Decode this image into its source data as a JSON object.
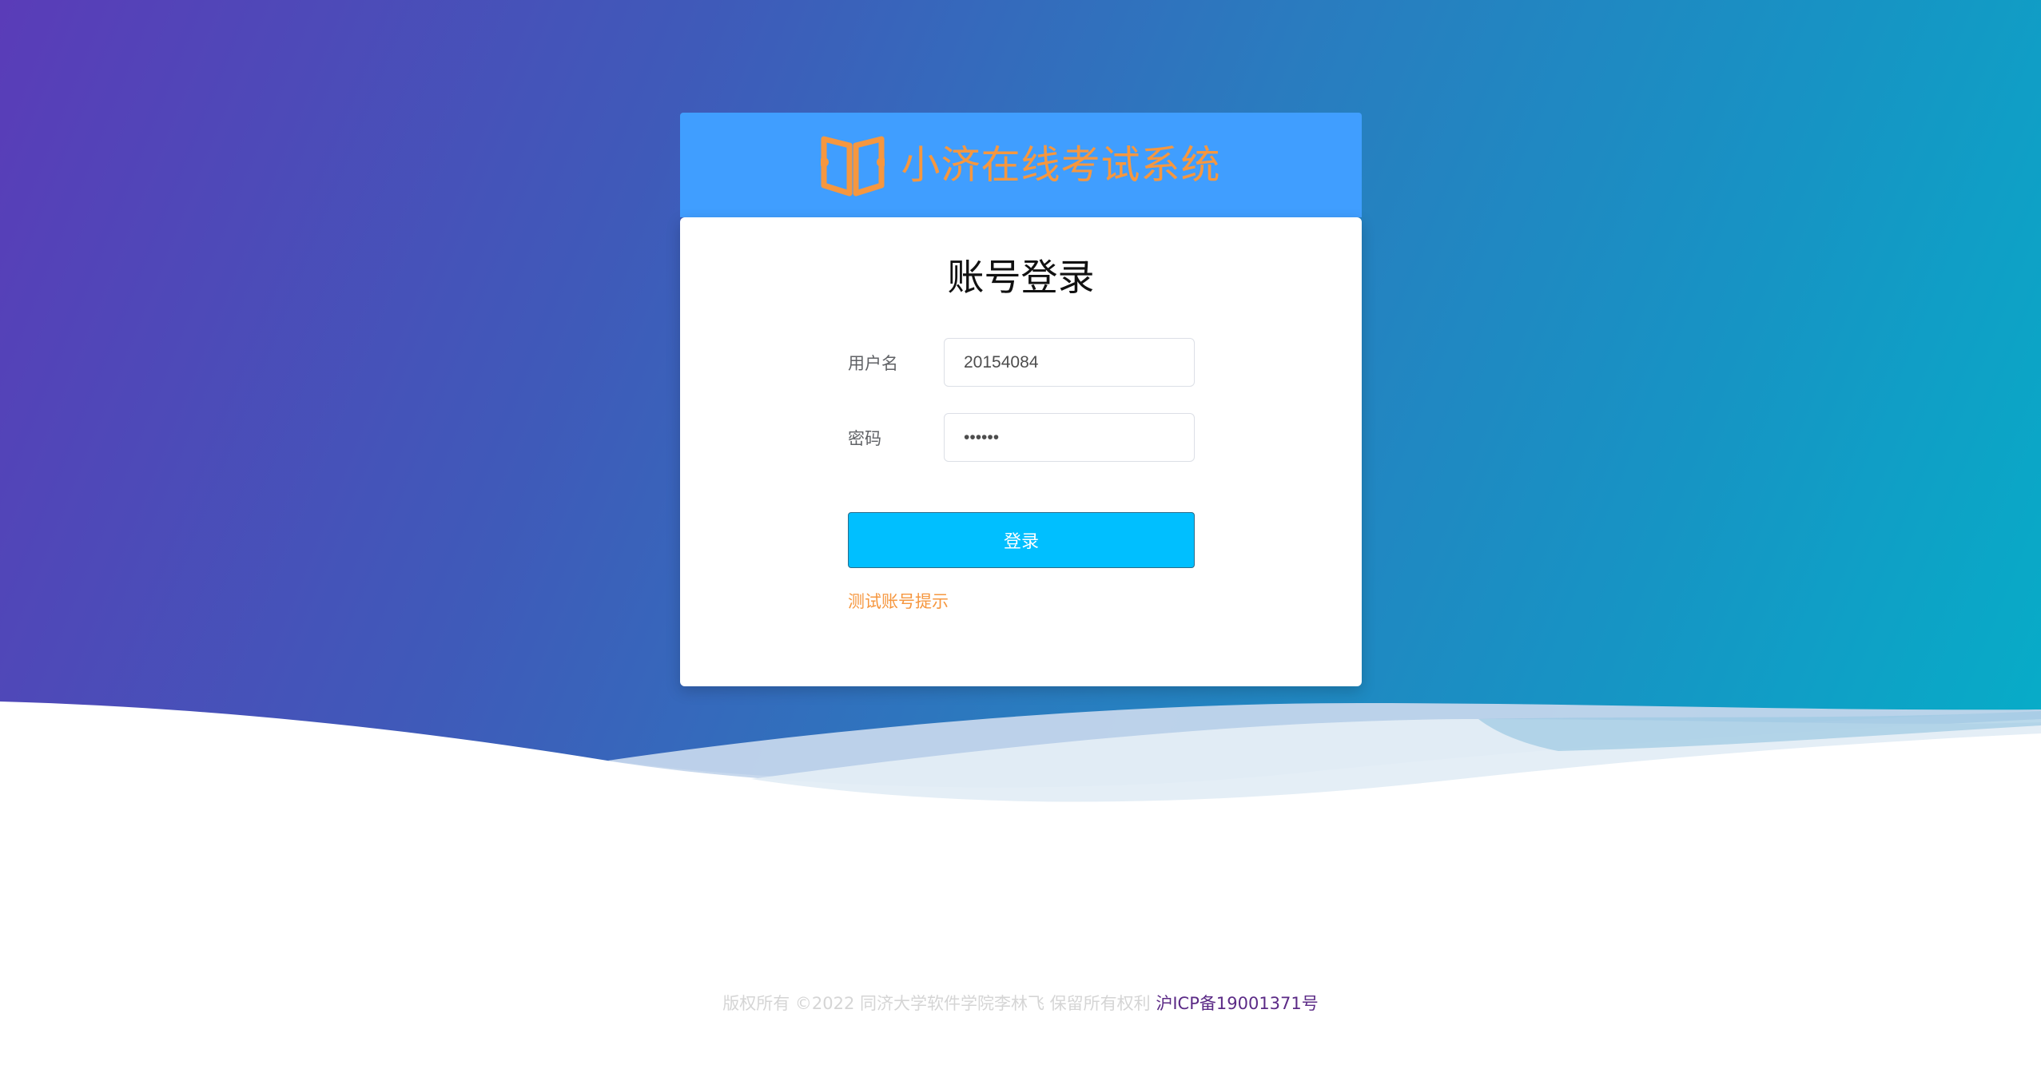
{
  "header": {
    "app_title": "小济在线考试系统",
    "logo_icon": "book-open-icon"
  },
  "login": {
    "title": "账号登录",
    "username_label": "用户名",
    "username_value": "20154084",
    "password_label": "密码",
    "password_value": "••••••",
    "submit_label": "登录",
    "hint_link": "测试账号提示"
  },
  "footer": {
    "copyright": "版权所有 ©2022 同济大学软件学院李林飞 保留所有权利",
    "icp": "沪ICP备19001371号"
  },
  "colors": {
    "brand_blue": "#409eff",
    "accent_orange": "#f6973f",
    "button_cyan": "#00bfff",
    "gradient_start": "#5a3cb8",
    "gradient_end": "#06aec8"
  }
}
